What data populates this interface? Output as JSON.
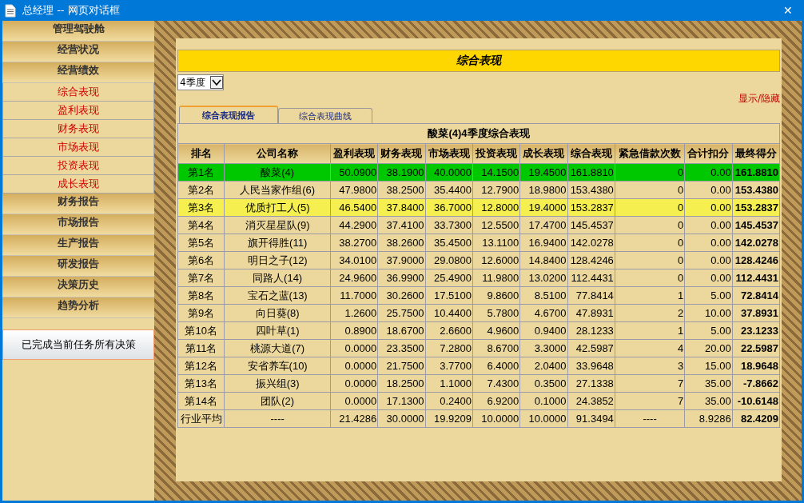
{
  "window": {
    "title": "总经理 -- 网页对话框",
    "close": "✕"
  },
  "sidebar": {
    "items": [
      {
        "label": "管理驾驶舱"
      },
      {
        "label": "经营状况"
      },
      {
        "label": "经营绩效",
        "children": [
          {
            "label": "综合表现"
          },
          {
            "label": "盈利表现"
          },
          {
            "label": "财务表现"
          },
          {
            "label": "市场表现"
          },
          {
            "label": "投资表现"
          },
          {
            "label": "成长表现"
          }
        ]
      },
      {
        "label": "财务报告"
      },
      {
        "label": "市场报告"
      },
      {
        "label": "生产报告"
      },
      {
        "label": "研发报告"
      },
      {
        "label": "决策历史"
      },
      {
        "label": "趋势分析"
      }
    ],
    "button": "已完成当前任务所有决策"
  },
  "heading": "综合表现",
  "quarter_select": {
    "value": "4季度"
  },
  "toggle_link": "显示/隐藏",
  "tabs": [
    {
      "label": "综合表现报告",
      "selected": true
    },
    {
      "label": "综合表现曲线",
      "selected": false
    }
  ],
  "table": {
    "caption": "酸菜(4)4季度综合表现",
    "columns": [
      "排名",
      "公司名称",
      "盈利表现",
      "财务表现",
      "市场表现",
      "投资表现",
      "成长表现",
      "综合表现",
      "紧急借款次数",
      "合计扣分",
      "最终得分"
    ],
    "rows": [
      {
        "color": "#00c800",
        "cells": [
          "第1名",
          "酸菜(4)",
          "50.0900",
          "38.1900",
          "40.0000",
          "14.1500",
          "19.4500",
          "161.8810",
          "0",
          "0.00",
          "161.8810"
        ]
      },
      {
        "color": "#ecd89c",
        "cells": [
          "第2名",
          "人民当家作组(6)",
          "47.9800",
          "38.2500",
          "35.4400",
          "12.7900",
          "18.9800",
          "153.4380",
          "0",
          "0.00",
          "153.4380"
        ]
      },
      {
        "color": "#f5f050",
        "cells": [
          "第3名",
          "优质打工人(5)",
          "46.5400",
          "37.8400",
          "36.7000",
          "12.8000",
          "19.4000",
          "153.2837",
          "0",
          "0.00",
          "153.2837"
        ]
      },
      {
        "color": "#ecd89c",
        "cells": [
          "第4名",
          "消灭星星队(9)",
          "44.2900",
          "37.4100",
          "33.7300",
          "12.5500",
          "17.4700",
          "145.4537",
          "0",
          "0.00",
          "145.4537"
        ]
      },
      {
        "color": "#ecd89c",
        "cells": [
          "第5名",
          "旗开得胜(11)",
          "38.2700",
          "38.2600",
          "35.4500",
          "13.1100",
          "16.9400",
          "142.0278",
          "0",
          "0.00",
          "142.0278"
        ]
      },
      {
        "color": "#ecd89c",
        "cells": [
          "第6名",
          "明日之子(12)",
          "34.0100",
          "37.9000",
          "29.0800",
          "12.6000",
          "14.8400",
          "128.4246",
          "0",
          "0.00",
          "128.4246"
        ]
      },
      {
        "color": "#ecd89c",
        "cells": [
          "第7名",
          "同路人(14)",
          "24.9600",
          "36.9900",
          "25.4900",
          "11.9800",
          "13.0200",
          "112.4431",
          "0",
          "0.00",
          "112.4431"
        ]
      },
      {
        "color": "#ecd89c",
        "cells": [
          "第8名",
          "宝石之蓝(13)",
          "11.7000",
          "30.2600",
          "17.5100",
          "9.8600",
          "8.5100",
          "77.8414",
          "1",
          "5.00",
          "72.8414"
        ]
      },
      {
        "color": "#ecd89c",
        "cells": [
          "第9名",
          "向日葵(8)",
          "1.2600",
          "25.7500",
          "10.4400",
          "5.7800",
          "4.6700",
          "47.8931",
          "2",
          "10.00",
          "37.8931"
        ]
      },
      {
        "color": "#ecd89c",
        "cells": [
          "第10名",
          "四叶草(1)",
          "0.8900",
          "18.6700",
          "2.6600",
          "4.9600",
          "0.9400",
          "28.1233",
          "1",
          "5.00",
          "23.1233"
        ]
      },
      {
        "color": "#ecd89c",
        "cells": [
          "第11名",
          "桃源大道(7)",
          "0.0000",
          "23.3500",
          "7.2800",
          "8.6700",
          "3.3000",
          "42.5987",
          "4",
          "20.00",
          "22.5987"
        ]
      },
      {
        "color": "#ecd89c",
        "cells": [
          "第12名",
          "安省养车(10)",
          "0.0000",
          "21.7500",
          "3.7700",
          "6.4000",
          "2.0400",
          "33.9648",
          "3",
          "15.00",
          "18.9648"
        ]
      },
      {
        "color": "#ecd89c",
        "cells": [
          "第13名",
          "振兴组(3)",
          "0.0000",
          "18.2500",
          "1.1000",
          "7.4300",
          "0.3500",
          "27.1338",
          "7",
          "35.00",
          "-7.8662"
        ]
      },
      {
        "color": "#ecd89c",
        "cells": [
          "第14名",
          "团队(2)",
          "0.0000",
          "17.1300",
          "0.2400",
          "6.9200",
          "0.1000",
          "24.3852",
          "7",
          "35.00",
          "-10.6148"
        ]
      }
    ],
    "average": [
      "行业平均",
      "----",
      "21.4286",
      "30.0000",
      "19.9209",
      "10.0000",
      "10.0000",
      "91.3494",
      "----",
      "8.9286",
      "82.4209"
    ]
  }
}
